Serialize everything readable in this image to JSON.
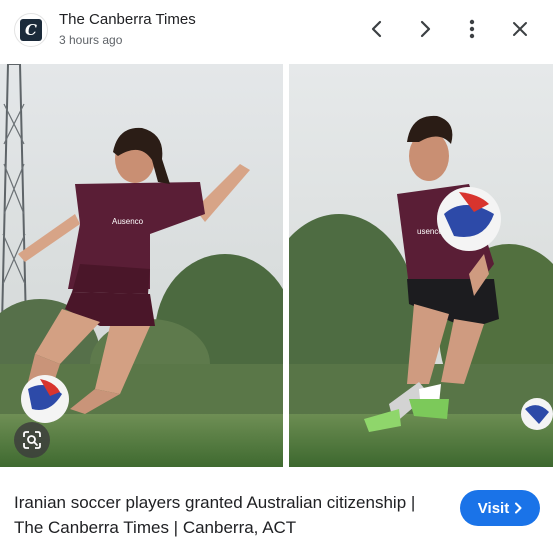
{
  "header": {
    "source_name": "The Canberra Times",
    "timestamp": "3 hours ago",
    "logo_letter": "C",
    "logo_icon": "canberra-times-logo-icon",
    "nav_icons": [
      "chevron-left-icon",
      "chevron-right-icon",
      "more-vert-icon",
      "close-icon"
    ]
  },
  "image": {
    "panels": [
      {
        "name": "photo-left",
        "jersey_text": "Ausenco"
      },
      {
        "name": "photo-right",
        "jersey_text": "usenco"
      }
    ],
    "lens_icon": "lens-search-icon"
  },
  "result": {
    "caption": "Iranian soccer players granted Australian citizenship | The Canberra Times | Canberra, ACT",
    "visit_label": "Visit",
    "visit_icon": "chevron-right-icon"
  },
  "colors": {
    "accent": "#1a73e8",
    "text_primary": "#202124",
    "text_secondary": "#5f6368",
    "jersey": "#5a1e36",
    "grass": "#4f7a3c"
  }
}
